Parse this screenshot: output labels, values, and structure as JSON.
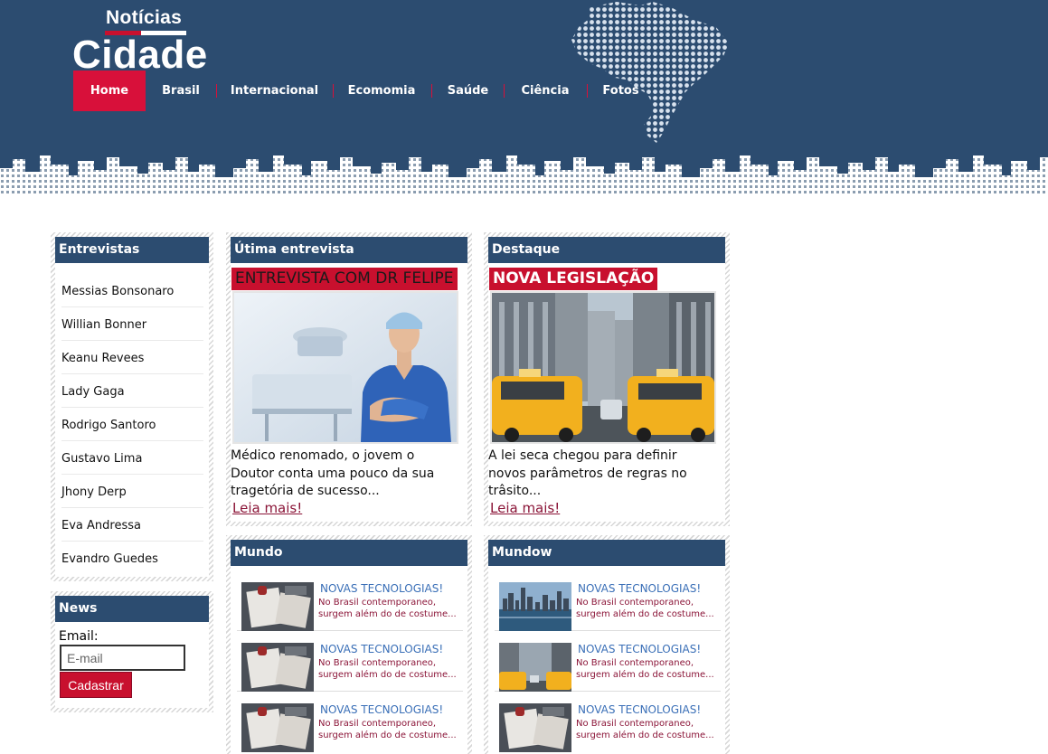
{
  "logo": {
    "top": "Notícias",
    "main": "Cidade"
  },
  "nav": {
    "items": [
      "Home",
      "Brasil",
      "Internacional",
      "Ecomomia",
      "Saúde",
      "Ciência",
      "Fotos"
    ]
  },
  "sidebar": {
    "title": "Entrevistas",
    "items": [
      "Messias Bonsonaro",
      "Willian Bonner",
      "Keanu Revees",
      "Lady Gaga",
      "Rodrigo Santoro",
      "Gustavo Lima",
      "Jhony Derp",
      "Eva Andressa",
      "Evandro Guedes"
    ]
  },
  "newsletter": {
    "title": "News",
    "label": "Email:",
    "placeholder": "E-mail",
    "button": "Cadastrar"
  },
  "interview": {
    "title": "Útima entrevista",
    "banner": "ENTREVISTA COM DR FELIPE",
    "text": "Médico renomado, o jovem o Doutor conta uma pouco da sua tragetória de sucesso...",
    "link": "Leia mais!"
  },
  "highlight": {
    "title": "Destaque",
    "banner": "NOVA LEGISLAÇÃO",
    "text": "A lei seca chegou para definir novos parâmetros de regras no trâsito...",
    "link": "Leia mais!"
  },
  "mundo": {
    "title": "Mundo",
    "items": [
      {
        "title": "NOVAS TECNOLOGIAS!",
        "line1": "No Brasil contemporaneo,",
        "line2": "surgem além do de costume...",
        "thumb": "notebook"
      },
      {
        "title": "NOVAS TECNOLOGIAS!",
        "line1": "No Brasil contemporaneo,",
        "line2": "surgem além do de costume...",
        "thumb": "notebook"
      },
      {
        "title": "NOVAS TECNOLOGIAS!",
        "line1": "No Brasil contemporaneo,",
        "line2": "surgem além do de costume...",
        "thumb": "notebook"
      }
    ]
  },
  "mundow": {
    "title": "Mundow",
    "items": [
      {
        "title": "NOVAS TECNOLOGIAS!",
        "line1": "No Brasil contemporaneo,",
        "line2": "surgem além do de costume...",
        "thumb": "skyline"
      },
      {
        "title": "NOVAS TECNOLOGIAS!",
        "line1": "No Brasil contemporaneo,",
        "line2": "surgem além do de costume...",
        "thumb": "city-taxi"
      },
      {
        "title": "NOVAS TECNOLOGIAS!",
        "line1": "No Brasil contemporaneo,",
        "line2": "surgem além do de costume...",
        "thumb": "notebook"
      }
    ]
  },
  "colors": {
    "navy": "#2c4c70",
    "red": "#c8102e",
    "link": "#3a6fb7",
    "maroon": "#8b1538"
  }
}
